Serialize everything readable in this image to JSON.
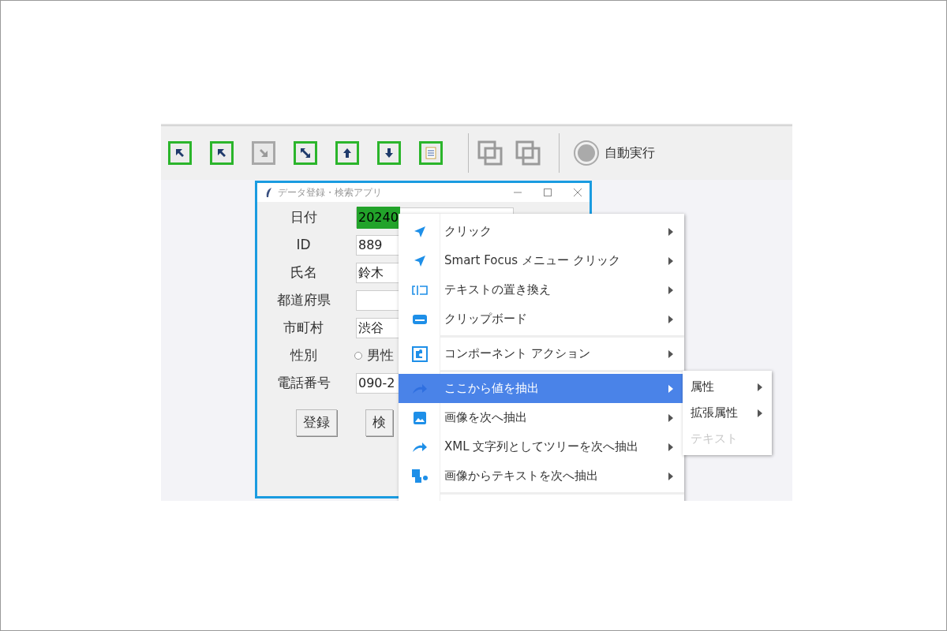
{
  "toolbar": {
    "buttons": [
      {
        "kind": "framed",
        "disabled": false
      },
      {
        "kind": "framed",
        "disabled": false
      },
      {
        "kind": "framed",
        "disabled": true
      },
      {
        "kind": "framed",
        "disabled": false
      },
      {
        "kind": "framed",
        "disabled": false
      },
      {
        "kind": "framed",
        "disabled": false
      },
      {
        "kind": "framed",
        "disabled": false
      },
      {
        "kind": "separator"
      },
      {
        "kind": "plain",
        "disabled": true
      },
      {
        "kind": "plain",
        "disabled": true
      },
      {
        "kind": "separator"
      }
    ],
    "auto_run": {
      "label": "自動実行",
      "disabled": true
    }
  },
  "window": {
    "title": "データ登録・検索アプリ",
    "rows": [
      {
        "kind": "field",
        "label": "日付",
        "value": "20240",
        "highlighted": true
      },
      {
        "kind": "field",
        "label": "ID",
        "value": "889"
      },
      {
        "kind": "field",
        "label": "氏名",
        "value": "鈴木"
      },
      {
        "kind": "field",
        "label": "都道府県"
      },
      {
        "kind": "field",
        "label": "市町村",
        "value": "渋谷"
      },
      {
        "kind": "radio",
        "label": "性別",
        "option": "男性",
        "selected": false
      },
      {
        "kind": "field",
        "label": "電話番号",
        "value": "090-2"
      }
    ],
    "buttons": [
      "登録",
      "検"
    ]
  },
  "context_menu": {
    "items": [
      {
        "kind": "item",
        "label": "クリック",
        "selected": false
      },
      {
        "kind": "item",
        "label": "Smart Focus メニュー クリック",
        "selected": false
      },
      {
        "kind": "item",
        "label": "テキストの置き換え",
        "selected": false
      },
      {
        "kind": "item",
        "label": "クリップボード",
        "selected": false
      },
      {
        "kind": "separator"
      },
      {
        "kind": "item",
        "label": "コンポーネント アクション",
        "selected": false
      },
      {
        "kind": "separator"
      },
      {
        "kind": "item",
        "label": "ここから値を抽出",
        "selected": true
      },
      {
        "kind": "item",
        "label": "画像を次へ抽出",
        "selected": false
      },
      {
        "kind": "item",
        "label": "XML 文字列としてツリーを次へ抽出",
        "selected": false
      },
      {
        "kind": "item",
        "label": "画像からテキストを次へ抽出",
        "selected": false
      },
      {
        "kind": "separator"
      }
    ]
  },
  "submenu": {
    "items": [
      {
        "label": "属性",
        "submenu": true,
        "disabled": false
      },
      {
        "label": "拡張属性",
        "submenu": true,
        "disabled": false
      },
      {
        "label": "テキスト",
        "submenu": false,
        "disabled": true
      }
    ]
  }
}
